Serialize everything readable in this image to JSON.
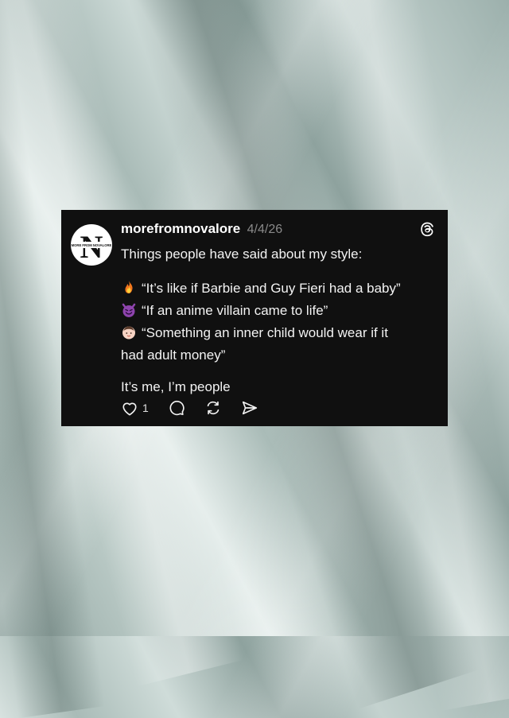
{
  "post": {
    "username": "morefromnovalore",
    "date": "4/4/26",
    "intro": "Things people have said about my style:",
    "quotes": [
      {
        "icon": "fire-emoji",
        "text": "“It’s like if Barbie and Guy Fieri had a baby”"
      },
      {
        "icon": "smiling-devil-emoji",
        "text": "“If an anime villain came to life”"
      },
      {
        "icon": "baby-emoji",
        "text": "“Something an inner child would wear if it",
        "text_cont": "had adult money”"
      }
    ],
    "closing": "It’s me, I’m people",
    "avatar": {
      "letter": "N",
      "tagline": "MORE FROM NOVALORE"
    },
    "actions": {
      "like_count": "1"
    }
  },
  "colors": {
    "card_background": "#101010",
    "text": "#f3f3f3",
    "date": "#8a8a8a"
  }
}
